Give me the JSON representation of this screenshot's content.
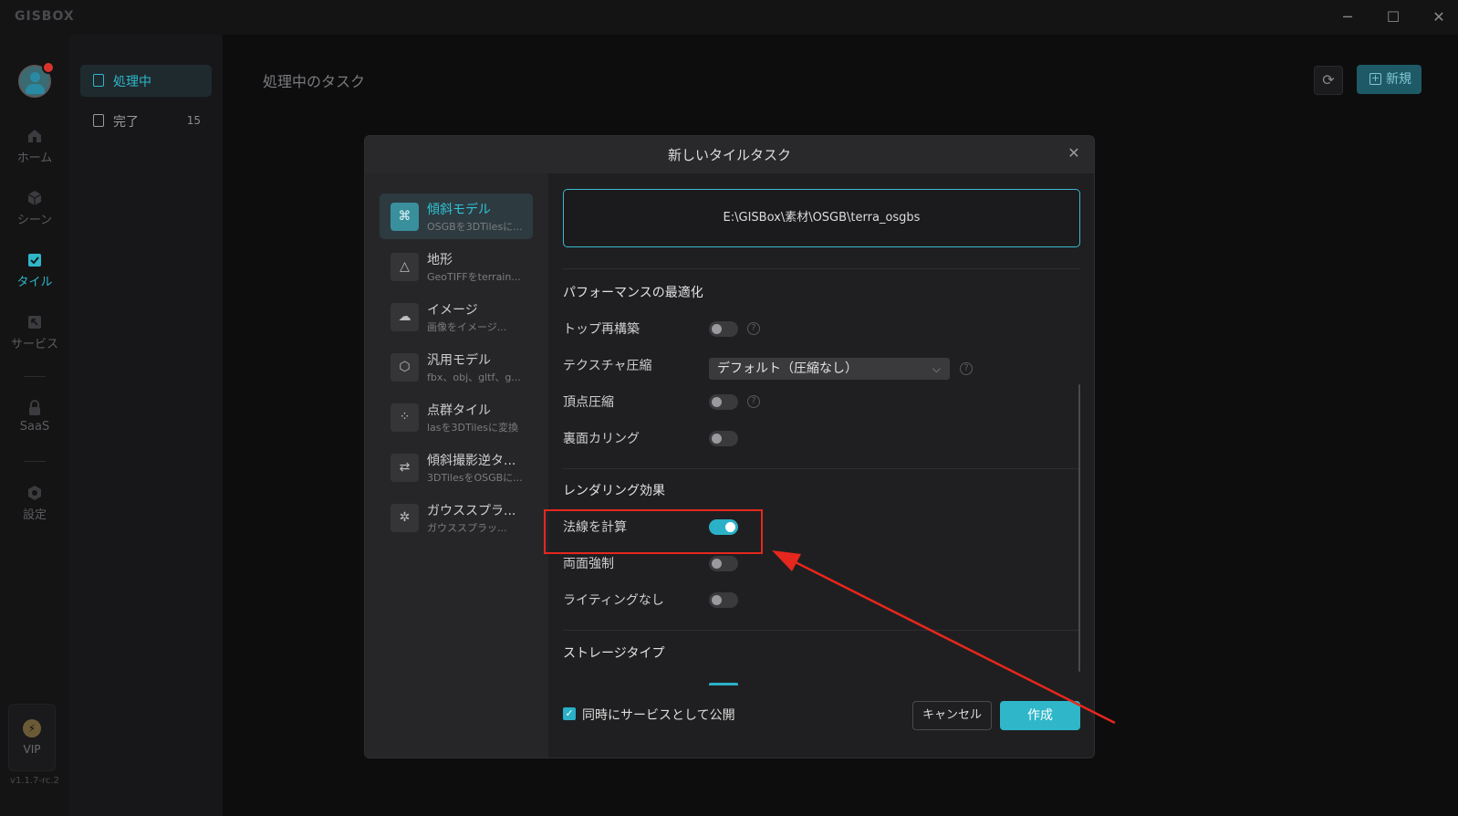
{
  "app": {
    "logo": "GISBOX",
    "version": "v1.1.7-rc.2"
  },
  "window": {
    "minimize_icon": "minimize-icon",
    "maximize_icon": "maximize-icon",
    "close_icon": "close-icon"
  },
  "rail": {
    "items": [
      {
        "label": "ホーム",
        "icon": "home-icon"
      },
      {
        "label": "シーン",
        "icon": "cube-icon"
      },
      {
        "label": "タイル",
        "icon": "tile-icon"
      },
      {
        "label": "サービス",
        "icon": "service-icon"
      },
      {
        "label": "SaaS",
        "icon": "lock-icon"
      },
      {
        "label": "設定",
        "icon": "gear-icon"
      }
    ],
    "vip_label": "VIP"
  },
  "subside": {
    "items": [
      {
        "label": "処理中",
        "count": ""
      },
      {
        "label": "完了",
        "count": "15"
      }
    ]
  },
  "main": {
    "title": "処理中のタスク",
    "new_label": "新規"
  },
  "modal": {
    "title": "新しいタイルタスク",
    "types": [
      {
        "name": "傾斜モデル",
        "desc": "OSGBを3DTilesに..."
      },
      {
        "name": "地形",
        "desc": "GeoTIFFをterrain..."
      },
      {
        "name": "イメージ",
        "desc": "画像をイメージ..."
      },
      {
        "name": "汎用モデル",
        "desc": "fbx、obj、gltf、g..."
      },
      {
        "name": "点群タイル",
        "desc": "lasを3DTilesに変換"
      },
      {
        "name": "傾斜撮影逆タ...",
        "desc": "3DTilesをOSGBに..."
      },
      {
        "name": "ガウススプラ...",
        "desc": "ガウススプラッ..."
      }
    ],
    "path": "E:\\GISBox\\素材\\OSGB\\terra_osgbs",
    "sections": {
      "performance": "パフォーマンスの最適化",
      "rendering": "レンダリング効果",
      "storage": "ストレージタイプ"
    },
    "options": {
      "top_rebuild": "トップ再構築",
      "texture_compress": "テクスチャ圧縮",
      "texture_value": "デフォルト（圧縮なし）",
      "vertex_compress": "頂点圧縮",
      "backface_culling": "裏面カリング",
      "compute_normals": "法線を計算",
      "double_sided": "両面強制",
      "no_lighting": "ライティングなし"
    },
    "toggles": {
      "top_rebuild": false,
      "vertex_compress": false,
      "backface_culling": false,
      "compute_normals": true,
      "double_sided": false,
      "no_lighting": false
    },
    "footer": {
      "publish_label": "同時にサービスとして公開",
      "publish_checked": true,
      "cancel_label": "キャンセル",
      "create_label": "作成"
    }
  },
  "colors": {
    "accent": "#2fb6c9",
    "annotation": "#e5271d",
    "background": "#0d0d0e"
  }
}
